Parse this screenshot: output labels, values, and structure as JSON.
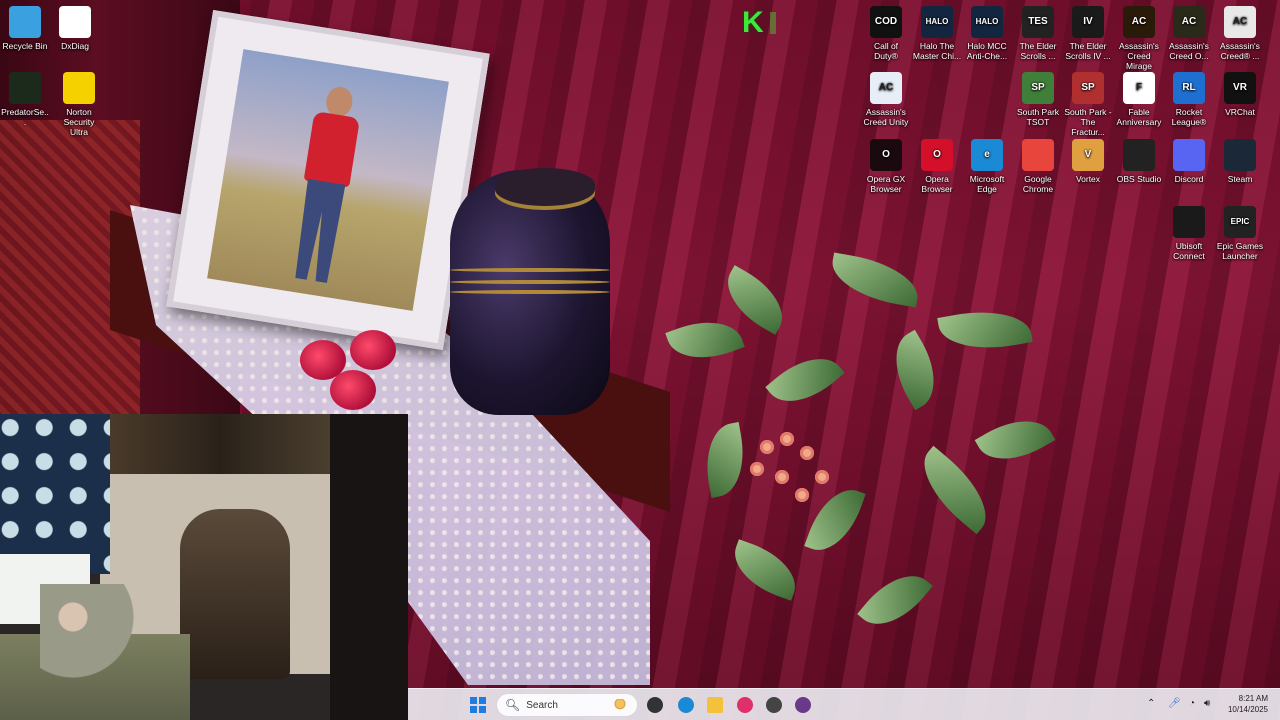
{
  "desktop_icons": [
    {
      "label": "Recycle Bin",
      "icon": "recycle-bin-icon",
      "color": "#3aa0e0"
    },
    {
      "label": "DxDiag",
      "icon": "document-icon",
      "color": "#ffffff"
    },
    {
      "label": "PredatorSe...",
      "icon": "predator-sense-icon",
      "color": "#1c2a1c"
    },
    {
      "label": "Norton Security Ultra",
      "icon": "norton-icon",
      "color": "#f6d100"
    },
    {
      "label": "Call of Duty®",
      "icon": "call-of-duty-icon",
      "color": "#111111",
      "glyph": "COD"
    },
    {
      "label": "Halo The Master Chi...",
      "icon": "halo-icon",
      "color": "#12263f",
      "glyph": "HALO"
    },
    {
      "label": "Halo MCC Anti-Che...",
      "icon": "halo-mcc-icon",
      "color": "#12263f",
      "glyph": "HALO"
    },
    {
      "label": "The Elder Scrolls ...",
      "icon": "elder-scrolls-icon",
      "color": "#222222",
      "glyph": "TES"
    },
    {
      "label": "The Elder Scrolls IV ...",
      "icon": "oblivion-icon",
      "color": "#1a1a1a",
      "glyph": "IV"
    },
    {
      "label": "Assassin's Creed Mirage",
      "icon": "ac-mirage-icon",
      "color": "#2a1a0a",
      "glyph": "AC"
    },
    {
      "label": "Assassin's Creed O...",
      "icon": "ac-origins-icon",
      "color": "#2a2a1a",
      "glyph": "AC"
    },
    {
      "label": "Assassin's Creed® ...",
      "icon": "ac-icon",
      "color": "#e8e8e8",
      "glyph": "AC"
    },
    {
      "label": "Assassin's Creed Unity",
      "icon": "ac-unity-icon",
      "color": "#e8eef8",
      "glyph": "AC"
    },
    {
      "label": "South Park TSOT",
      "icon": "south-park-icon",
      "color": "#3f7f3a",
      "glyph": "SP"
    },
    {
      "label": "South Park - The Fractur...",
      "icon": "south-park-fbw-icon",
      "color": "#b03030",
      "glyph": "SP"
    },
    {
      "label": "Fable Anniversary",
      "icon": "fable-icon",
      "color": "#ffffff",
      "glyph": "F"
    },
    {
      "label": "Rocket League®",
      "icon": "rocket-league-icon",
      "color": "#1f6fd0",
      "glyph": "RL"
    },
    {
      "label": "VRChat",
      "icon": "vrchat-icon",
      "color": "#111111",
      "glyph": "VR"
    },
    {
      "label": "Opera GX Browser",
      "icon": "opera-gx-icon",
      "color": "#1a0a10",
      "glyph": "O"
    },
    {
      "label": "Opera Browser",
      "icon": "opera-icon",
      "color": "#d40f2a",
      "glyph": "O"
    },
    {
      "label": "Microsoft Edge",
      "icon": "edge-icon",
      "color": "#1a8ad4",
      "glyph": "e"
    },
    {
      "label": "Google Chrome",
      "icon": "chrome-icon",
      "color": "#e8453c",
      "glyph": ""
    },
    {
      "label": "Vortex",
      "icon": "vortex-icon",
      "color": "#e0a040",
      "glyph": "V"
    },
    {
      "label": "OBS Studio",
      "icon": "obs-icon",
      "color": "#222222",
      "glyph": ""
    },
    {
      "label": "Discord",
      "icon": "discord-icon",
      "color": "#5865f2",
      "glyph": ""
    },
    {
      "label": "Steam",
      "icon": "steam-icon",
      "color": "#1b2838",
      "glyph": ""
    },
    {
      "label": "Ubisoft Connect",
      "icon": "ubisoft-icon",
      "color": "#1a1a1a",
      "glyph": ""
    },
    {
      "label": "Epic Games Launcher",
      "icon": "epic-games-icon",
      "color": "#222222",
      "glyph": "EPIC"
    }
  ],
  "overlay_logo": "K",
  "taskbar": {
    "search_placeholder": "Search",
    "pinned": [
      {
        "icon": "task-view-icon",
        "color": "#333333"
      },
      {
        "icon": "edge-icon",
        "color": "#1a8ad4"
      },
      {
        "icon": "file-explorer-icon",
        "color": "#f3c23a"
      },
      {
        "icon": "opera-gx-icon",
        "color": "#e0306a"
      },
      {
        "icon": "app-icon",
        "color": "#444444"
      },
      {
        "icon": "app-icon",
        "color": "#6a3a8a"
      }
    ],
    "time": "8:21 AM",
    "date": "10/14/2025"
  }
}
